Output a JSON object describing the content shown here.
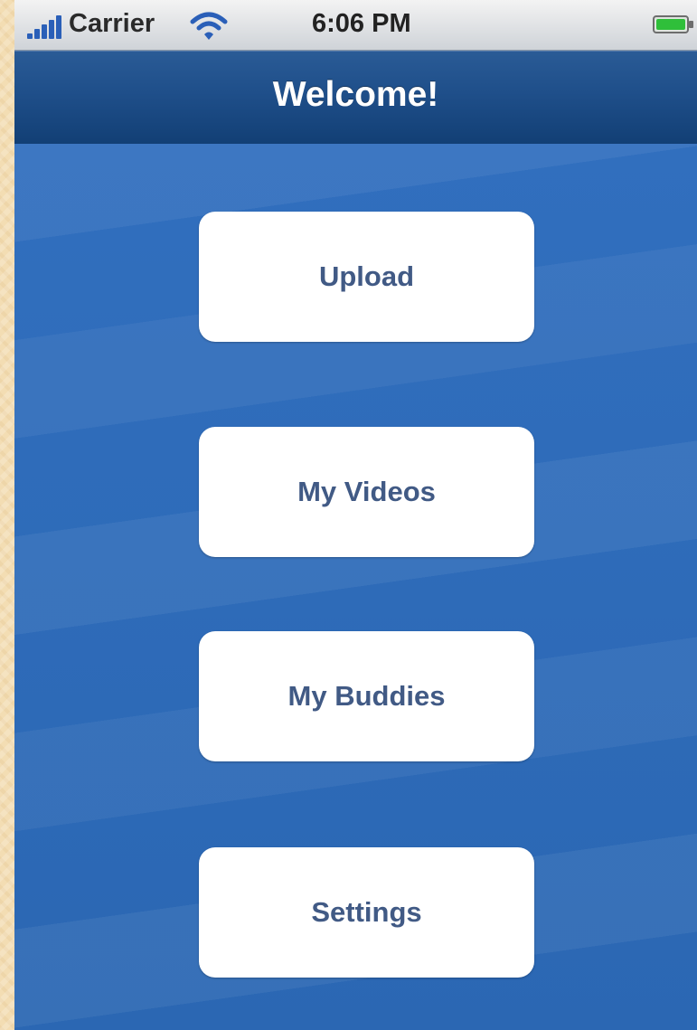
{
  "status_bar": {
    "carrier": "Carrier",
    "time": "6:06 PM",
    "signal_icon": "signal-bars-icon",
    "wifi_icon": "wifi-icon",
    "battery_icon": "battery-icon"
  },
  "nav_bar": {
    "title": "Welcome!"
  },
  "menu": {
    "items": [
      {
        "label": "Upload"
      },
      {
        "label": "My Videos"
      },
      {
        "label": "My Buddies"
      },
      {
        "label": "Settings"
      }
    ]
  },
  "colors": {
    "background": "#2f6fbb",
    "nav_bar": "#1f4f8a",
    "button_text": "#415a85",
    "button_bg": "#ffffff"
  }
}
